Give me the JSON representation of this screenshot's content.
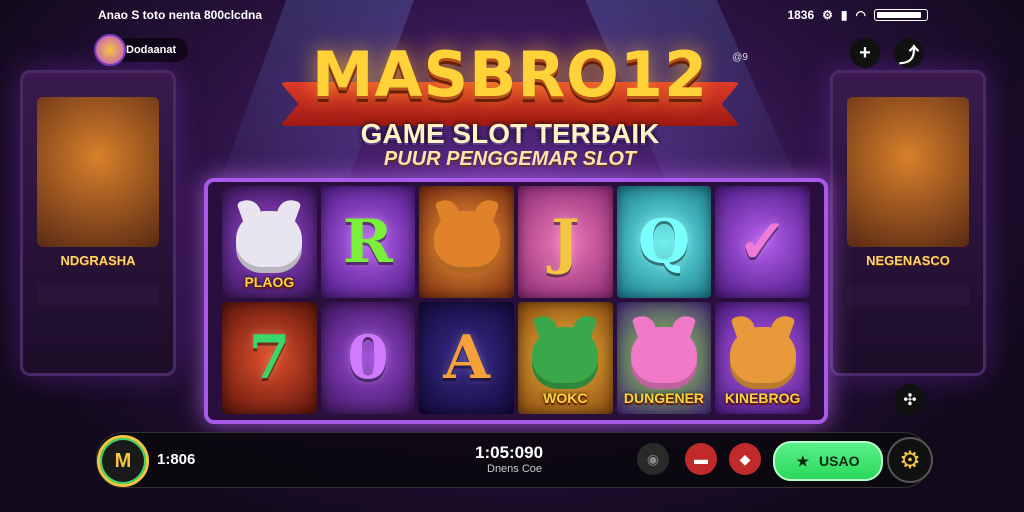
{
  "status_bar": {
    "left_text": "Anao S toto nenta 800clcdna",
    "time": "1836",
    "battery_level": 0.92
  },
  "profile": {
    "name": "Dodaanat"
  },
  "top_buttons": {
    "add": "+",
    "share": "⤴"
  },
  "title": {
    "brand": "MASBRO12",
    "tm": "@9",
    "subtitle": "GAME SLOT TERBAIK",
    "tagline": "PUUR PENGGEMAR SLOT"
  },
  "background_cabinets": {
    "left_label": "NDGRASHA",
    "right_label": "NEGENASCO"
  },
  "reels": [
    {
      "symbol": "dog",
      "label": "PLAOG",
      "icon": "dog-icon",
      "color": "purple"
    },
    {
      "symbol": "R",
      "label": "",
      "icon": "letter-r-icon",
      "color": "violet"
    },
    {
      "symbol": "fox",
      "label": "",
      "icon": "fox-icon",
      "color": "orange"
    },
    {
      "symbol": "J",
      "label": "",
      "icon": "letter-j-icon",
      "color": "pink"
    },
    {
      "symbol": "Q",
      "label": "",
      "icon": "letter-q-icon",
      "color": "cyan"
    },
    {
      "symbol": "✓",
      "label": "",
      "icon": "check-icon",
      "color": "violet"
    },
    {
      "symbol": "7",
      "label": "",
      "icon": "seven-icon",
      "color": "red"
    },
    {
      "symbol": "0",
      "label": "",
      "icon": "letter-o-icon",
      "color": "purple"
    },
    {
      "symbol": "A",
      "label": "",
      "icon": "letter-a-icon",
      "color": "navy"
    },
    {
      "symbol": "elf",
      "label": "WOKC",
      "icon": "elf-icon",
      "color": "gold"
    },
    {
      "symbol": "unicorn",
      "label": "DUNGENER",
      "icon": "unicorn-icon",
      "color": "green"
    },
    {
      "symbol": "lion",
      "label": "KINEBROG",
      "icon": "lion-icon",
      "color": "violet"
    }
  ],
  "bottom_bar": {
    "balance": "1:806",
    "center_value": "1:05:090",
    "center_sub": "Dnens Coe",
    "spin_label": "USAO",
    "colors": {
      "spin": "#2ad85a",
      "gear": "#f5c542",
      "logo_ring": "#f5c542"
    }
  }
}
